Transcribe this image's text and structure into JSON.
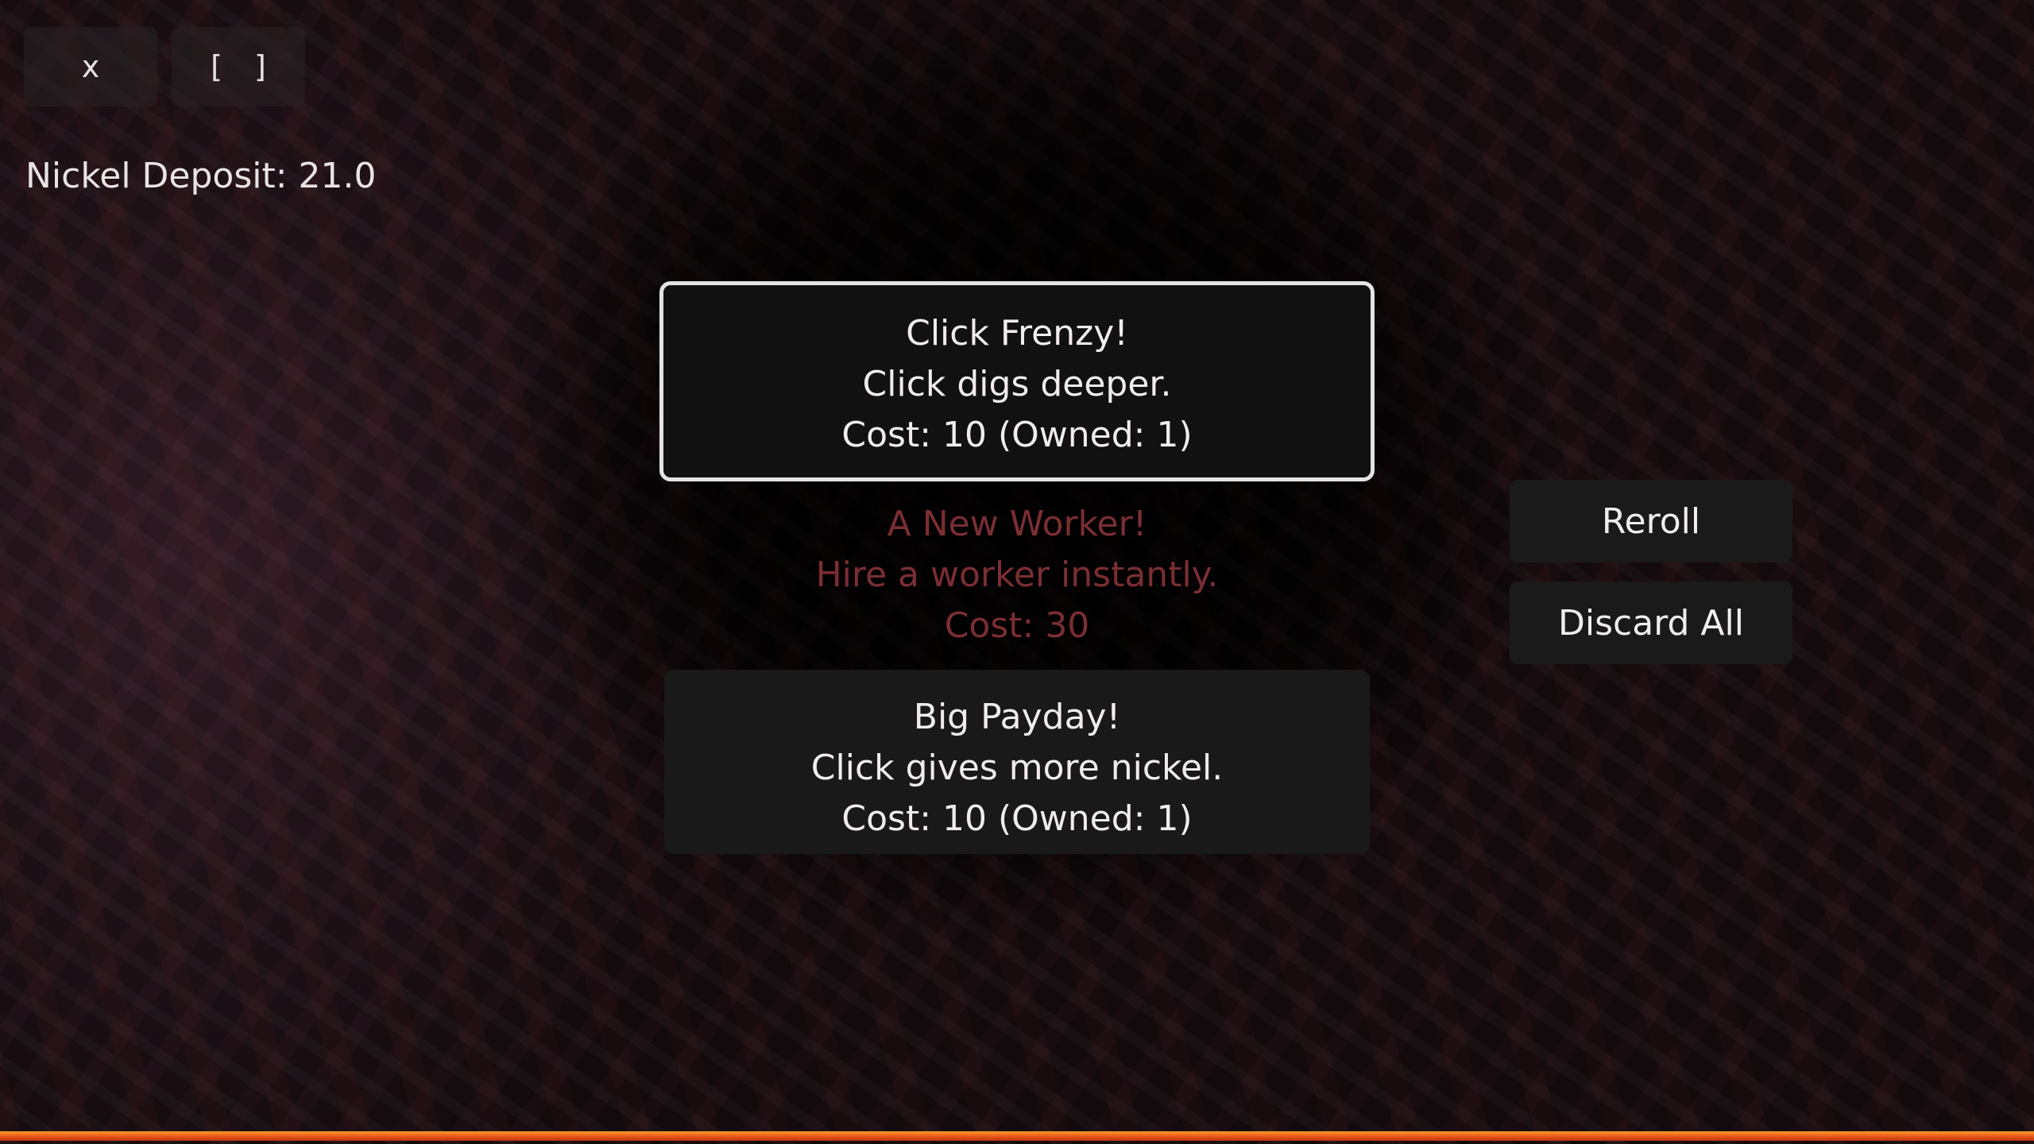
{
  "window_controls": {
    "close_label": "x",
    "maximize_label": "[ ]"
  },
  "resource": {
    "label": "Nickel Deposit: 21.0"
  },
  "upgrades": [
    {
      "title": "Click Frenzy!",
      "description": "Click digs deeper.",
      "cost": "Cost: 10 (Owned: 1)",
      "state": "selected"
    },
    {
      "title": "A New Worker!",
      "description": "Hire a worker instantly.",
      "cost": "Cost: 30",
      "state": "unaffordable"
    },
    {
      "title": "Big Payday!",
      "description": "Click gives more nickel.",
      "cost": "Cost: 10 (Owned: 1)",
      "state": "available"
    }
  ],
  "actions": {
    "reroll_label": "Reroll",
    "discard_label": "Discard All"
  },
  "progress": {
    "fraction": 1.0
  },
  "colors": {
    "selected_border": "#e4e4e4",
    "unaffordable_text": "#7a2e33",
    "progress_bar": "#e8561a"
  }
}
